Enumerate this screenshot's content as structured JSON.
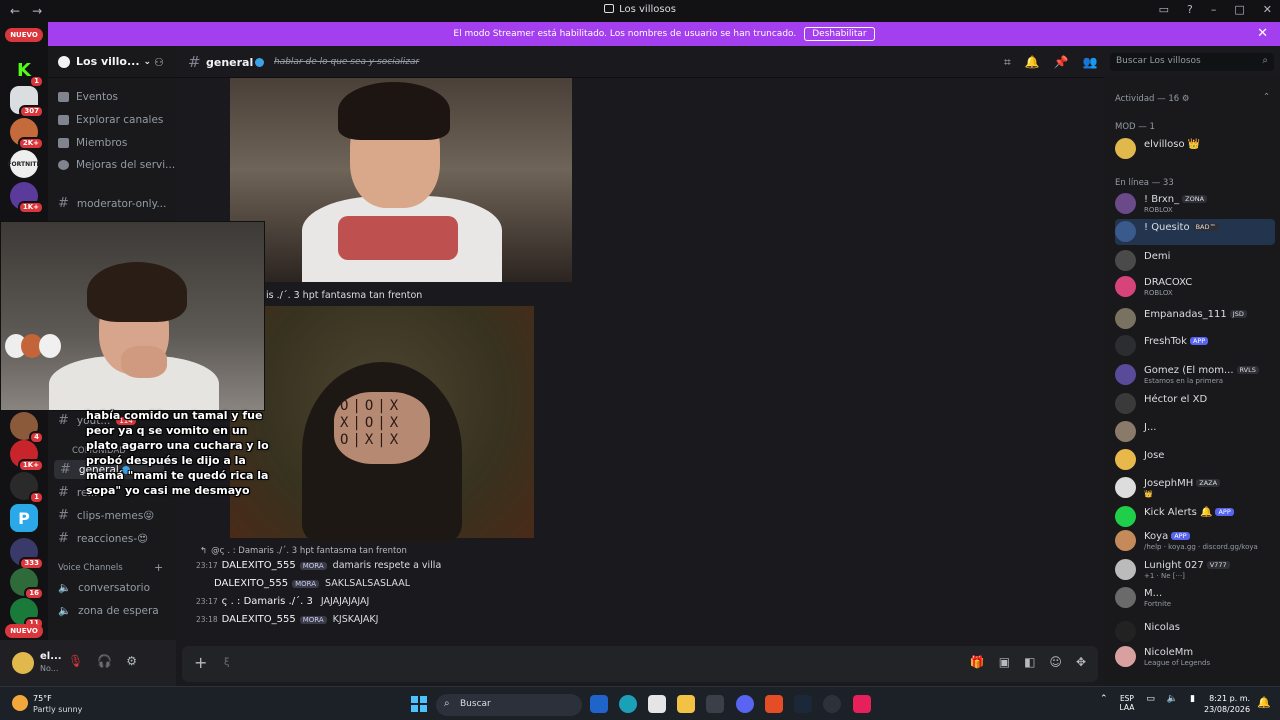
{
  "window": {
    "title": "Los villosos"
  },
  "banner": {
    "text": "El modo Streamer está habilitado. Los nombres de usuario se han truncado.",
    "button": "Deshabilitar"
  },
  "servers": {
    "new_top": "NUEVO",
    "new_bottom": "NUEVO",
    "badges": [
      "1",
      "307",
      "2K+",
      "1K+",
      "4",
      "1K+",
      "1",
      "333",
      "16",
      "11"
    ]
  },
  "guild": {
    "name": "Los villo..."
  },
  "channels": {
    "events": "Eventos",
    "explore": "Explorar canales",
    "members": "Miembros",
    "boosts": "Mejoras del servi...",
    "moderator": "moderator-only...",
    "hidden_label": "yout...",
    "hidden_badge": "114",
    "community_cat": "COMUNIDAD",
    "general": "general",
    "reglas": "re...",
    "clips": "clips-memes😝",
    "reacciones": "reacciones-😍",
    "voice_cat": "Voice Channels",
    "voice1": "conversatorio",
    "voice2": "zona de espera"
  },
  "user": {
    "name": "el...",
    "status": "No..."
  },
  "chat": {
    "channel": "general",
    "topic": "hablar de lo que sea y socializar",
    "caption_line": "is ./´. 3  hpt fantasma tan frenton",
    "reply_preview": "@ς . : Damaris ./´. 3  hpt fantasma tan frenton",
    "messages": [
      {
        "ts": "23:17",
        "user": "DALEXITO_555",
        "tag": "MORA",
        "text": "damaris respete a villa"
      },
      {
        "ts": "",
        "user": "DALEXITO_555",
        "tag": "MORA",
        "text": "SAKLSALSASLAAL"
      },
      {
        "ts": "23:17",
        "user": "ς . : Damaris ./´. 3",
        "tag": "",
        "text": "JAJAJAJAJAJ"
      },
      {
        "ts": "23:18",
        "user": "DALEXITO_555",
        "tag": "MORA",
        "text": "KJSKAJAKJ"
      }
    ],
    "composer_placeholder": "ξ"
  },
  "overlay": {
    "caption": "había comido un tamal y fue peor ya q se vomito en un plato agarro una cuchara y lo probó después le dijo a la mamá \"mami te quedó rica la sopa\" yo casi me desmayo"
  },
  "header": {
    "search_placeholder": "Buscar Los villosos"
  },
  "members": {
    "activity": "Actividad — 16",
    "mod_header": "MOD — 1",
    "online_header": "En línea — 33",
    "list": [
      {
        "name": "elvilloso 👑",
        "sub": "",
        "chip": "",
        "color": "#e0b84c"
      },
      {
        "name": "! Brxn_",
        "sub": "ROBLOX",
        "chip": "ZONA",
        "color": "#6b4a8a"
      },
      {
        "name": "! Quesito",
        "sub": "",
        "chip": "BAD™",
        "color": "#3a5a8c"
      },
      {
        "name": "Demi",
        "sub": "",
        "chip": "",
        "color": "#4a4a4a"
      },
      {
        "name": "DRACOXC",
        "sub": "ROBLOX",
        "chip": "",
        "color": "#d6447a"
      },
      {
        "name": "Empanadas_111",
        "sub": "",
        "chip": "JSD",
        "color": "#7a7260"
      },
      {
        "name": "FreshTok",
        "sub": "",
        "chip": "APP",
        "color": "#2b2d31"
      },
      {
        "name": "Gomez (El mom...",
        "sub": "Estamos en la primera",
        "chip": "RVLS",
        "color": "#5a4a9a"
      },
      {
        "name": "Héctor el XD",
        "sub": "",
        "chip": "",
        "color": "#3a3a3a"
      },
      {
        "name": "J...",
        "sub": "",
        "chip": "",
        "color": "#8a7a6a"
      },
      {
        "name": "Jose",
        "sub": "",
        "chip": "",
        "color": "#e8b84a"
      },
      {
        "name": "JosephMH",
        "sub": "👑",
        "chip": "ZAZA",
        "color": "#dddddd"
      },
      {
        "name": "Kick Alerts 🔔",
        "sub": "",
        "chip": "APP",
        "color": "#1fcf4a"
      },
      {
        "name": "Koya",
        "sub": "/help · koya.gg · discord.gg/koya",
        "chip": "APP",
        "color": "#c48a5a"
      },
      {
        "name": "Lunight 027",
        "sub": "+1 · Ne [···]",
        "chip": "V777",
        "color": "#bbbbbb"
      },
      {
        "name": "M...",
        "sub": "Fortnite",
        "chip": "",
        "color": "#6a6a6a"
      },
      {
        "name": "Nicolas",
        "sub": "",
        "chip": "",
        "color": "#222222"
      },
      {
        "name": "NicoleMm",
        "sub": "League of Legends",
        "chip": "",
        "color": "#d9a0a0"
      }
    ]
  },
  "taskbar": {
    "temp": "75°F",
    "condition": "Partly sunny",
    "search": "Buscar",
    "lang1": "ESP",
    "lang2": "LAA",
    "time": "8:21 p. m.",
    "date": "23/08/2026"
  }
}
